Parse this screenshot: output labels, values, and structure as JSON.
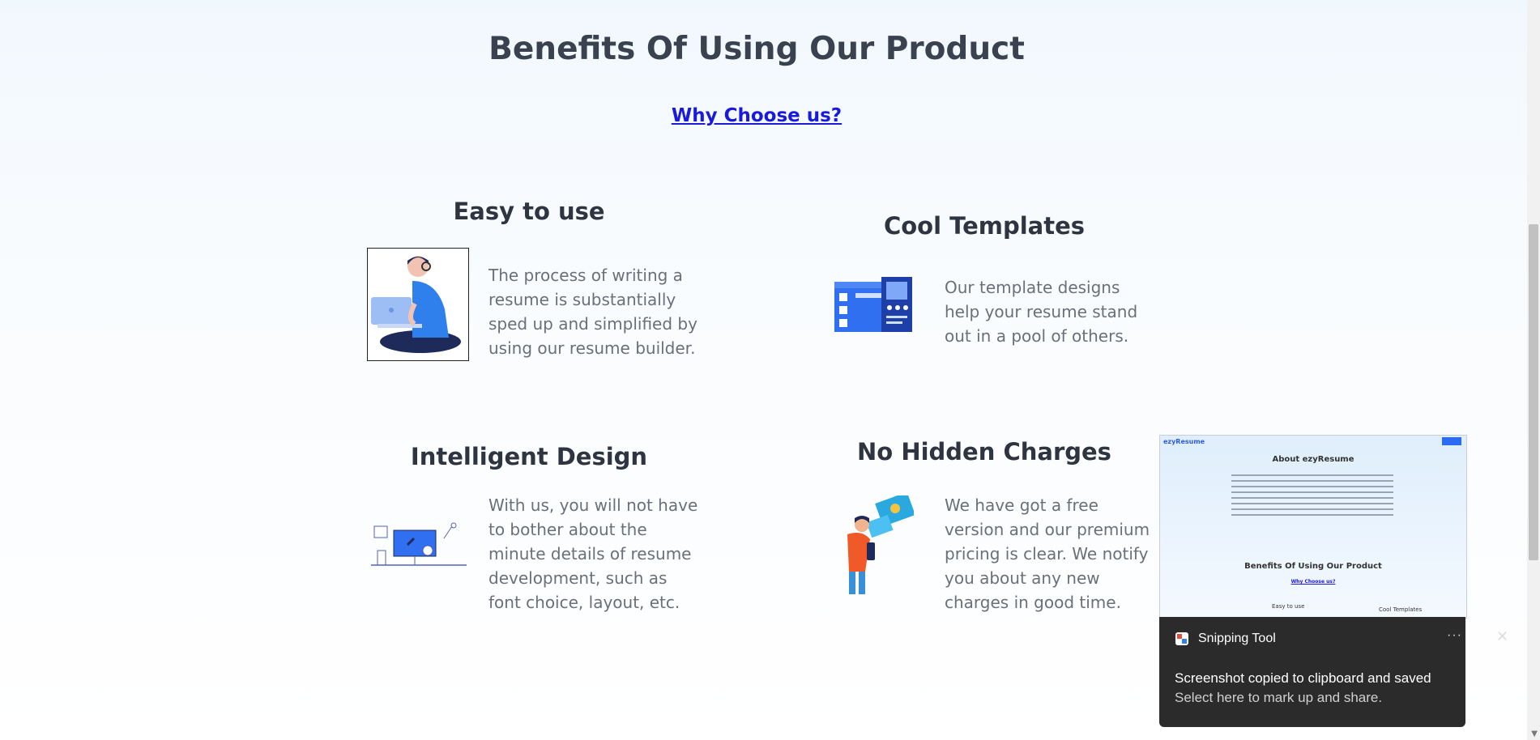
{
  "section": {
    "title": "Benefits Of Using Our Product",
    "why_link": "Why Choose us?"
  },
  "features": [
    {
      "title": "Easy to use",
      "text_lines": [
        "The process of writing a",
        "resume is substantially",
        "sped up and simplified by",
        "using our resume builder."
      ],
      "icon": "person-laptop-illustration"
    },
    {
      "title": "Cool Templates",
      "text_lines": [
        "Our template designs",
        "help your resume stand",
        "out in a pool of others."
      ],
      "icon": "template-layout-illustration"
    },
    {
      "title": "Intelligent Design",
      "text_lines": [
        "With us, you will not have",
        "to bother about the",
        "minute details of resume",
        "development, such as",
        "font choice, layout, etc."
      ],
      "icon": "design-desk-illustration"
    },
    {
      "title": "No Hidden Charges",
      "text_lines": [
        "We have got a free",
        "version and our premium",
        "pricing is clear. We notify",
        "you about any new",
        "charges in good time."
      ],
      "icon": "person-phone-illustration"
    }
  ],
  "thumbnail": {
    "logo": "ezyResume",
    "about_title": "About ezyResume",
    "benefits_title": "Benefits Of Using Our Product",
    "why_link": "Why Choose us?",
    "col1": "Easy to use",
    "col2": "Cool Templates"
  },
  "toast": {
    "app_name": "Snipping Tool",
    "more_icon": "more-icon",
    "close_icon": "close-icon",
    "title": "Screenshot copied to clipboard and saved",
    "subtitle": "Select here to mark up and share."
  },
  "colors": {
    "accent": "#1a1adc",
    "illustration_blue": "#2f6ff0"
  }
}
